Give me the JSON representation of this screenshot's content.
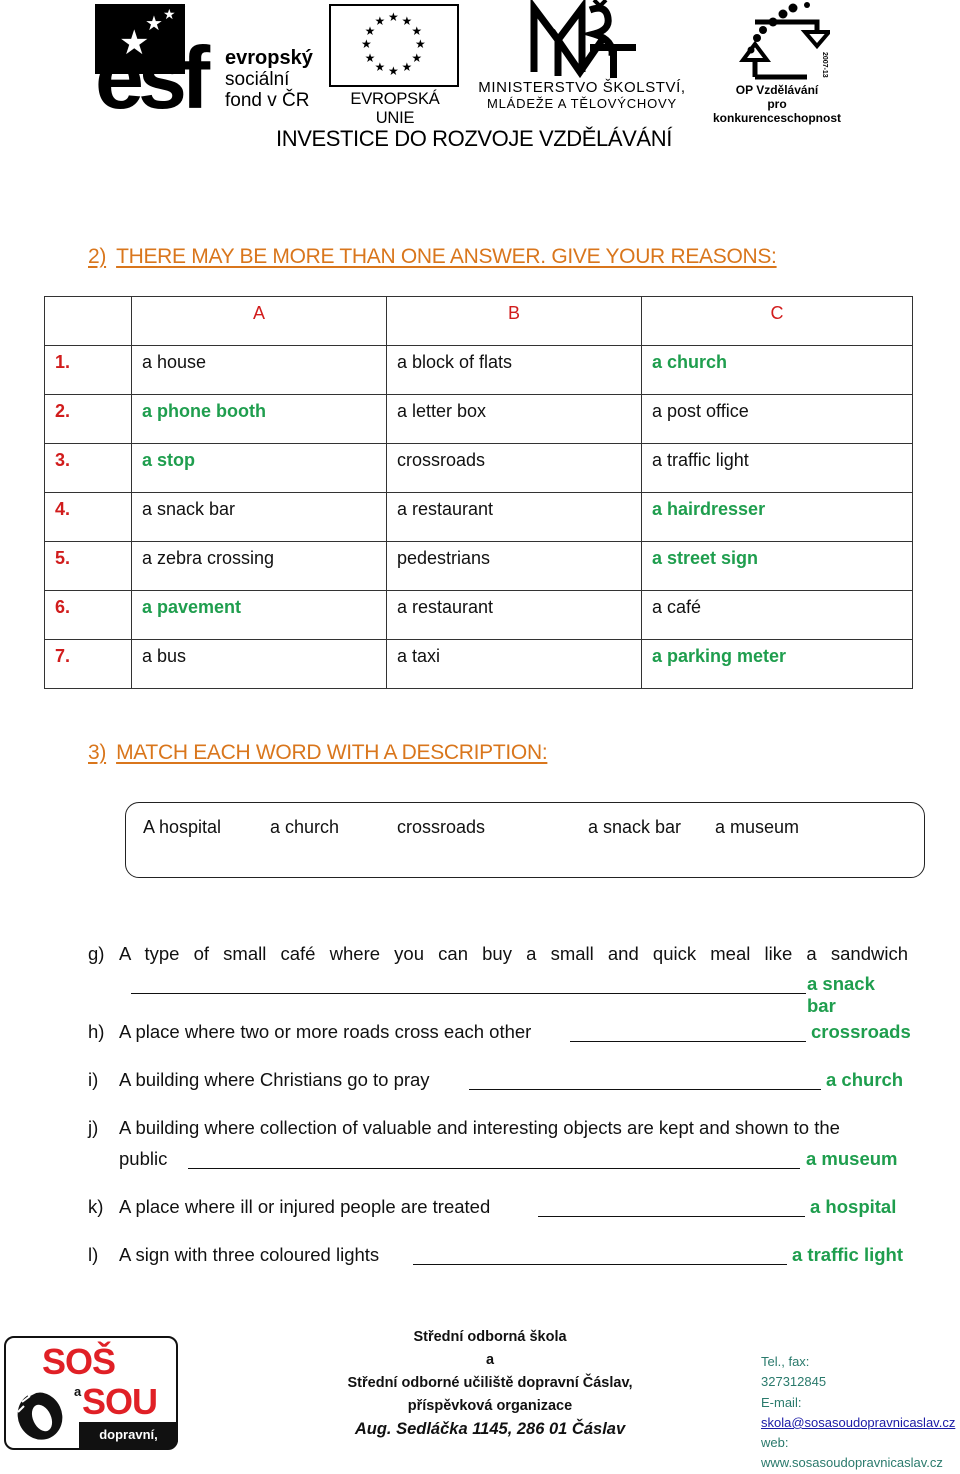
{
  "header": {
    "esf": {
      "letters": "esf",
      "line1": "evropský",
      "line2": "sociální",
      "line3": "fond v ČR"
    },
    "eu": {
      "label": "EVROPSKÁ UNIE"
    },
    "msmt": {
      "logo_text": "MŠMT",
      "line1": "MINISTERSTVO ŠKOLSTVÍ,",
      "line2": "MLÁDEŽE A TĚLOVÝCHOVY"
    },
    "op": {
      "year": "2007-13",
      "line1": "OP Vzdělávání",
      "line2": "pro konkurenceschopnost"
    },
    "tagline": "INVESTICE DO ROZVOJE VZDĚLÁVÁNÍ"
  },
  "colors": {
    "heading": "#d9761c",
    "number": "#d11c1c",
    "answer": "#1f9e4e",
    "contact": "#2a7a6c"
  },
  "section2": {
    "number": "2)",
    "title": "THERE MAY BE MORE THAN ONE ANSWER. GIVE YOUR REASONS:",
    "columns": [
      "A",
      "B",
      "C"
    ],
    "rows": [
      {
        "num": "1.",
        "cells": [
          {
            "text": "a house",
            "answer": false
          },
          {
            "text": "a block of flats",
            "answer": false
          },
          {
            "text": "a church",
            "answer": true
          }
        ]
      },
      {
        "num": "2.",
        "cells": [
          {
            "text": "a phone booth",
            "answer": true
          },
          {
            "text": "a letter box",
            "answer": false
          },
          {
            "text": "a post office",
            "answer": false
          }
        ]
      },
      {
        "num": "3.",
        "cells": [
          {
            "text": "a stop",
            "answer": true
          },
          {
            "text": "crossroads",
            "answer": false
          },
          {
            "text": "a traffic light",
            "answer": false
          }
        ]
      },
      {
        "num": "4.",
        "cells": [
          {
            "text": "a snack bar",
            "answer": false
          },
          {
            "text": "a restaurant",
            "answer": false
          },
          {
            "text": "a hairdresser",
            "answer": true
          }
        ]
      },
      {
        "num": "5.",
        "cells": [
          {
            "text": "a zebra crossing",
            "answer": false
          },
          {
            "text": "pedestrians",
            "answer": false
          },
          {
            "text": "a street sign",
            "answer": true
          }
        ]
      },
      {
        "num": "6.",
        "cells": [
          {
            "text": "a pavement",
            "answer": true
          },
          {
            "text": "a restaurant",
            "answer": false
          },
          {
            "text": "a café",
            "answer": false
          }
        ]
      },
      {
        "num": "7.",
        "cells": [
          {
            "text": "a bus",
            "answer": false
          },
          {
            "text": "a taxi",
            "answer": false
          },
          {
            "text": "a parking meter",
            "answer": true
          }
        ]
      }
    ]
  },
  "section3": {
    "number": "3)",
    "title": "MATCH EACH WORD WITH A DESCRIPTION:",
    "words": [
      "A hospital",
      "a church",
      "crossroads",
      "a snack bar",
      "a museum"
    ],
    "items": [
      {
        "label": "g)",
        "text": "A type of small café where you can buy a small and quick meal like a sandwich",
        "answer": "a snack bar"
      },
      {
        "label": "h)",
        "text": "A place where two or more roads cross each other",
        "answer": "crossroads"
      },
      {
        "label": "i)",
        "text": "A building where Christians go to pray",
        "answer": "a church"
      },
      {
        "label": "j)",
        "text": "A building where collection of valuable and  interesting objects are kept and shown to the",
        "text2": "public",
        "answer": "a museum"
      },
      {
        "label": "k)",
        "text": "A place where ill or injured people are treated",
        "answer": "a hospital"
      },
      {
        "label": "l)",
        "text": "A sign with three coloured lights",
        "answer": "a traffic light"
      }
    ]
  },
  "footer": {
    "logo": {
      "line1": "SOŠ",
      "connector": "a",
      "line2": "SOU",
      "subtitle": "dopravní, Čáslav"
    },
    "school": {
      "line1": "Střední odborná škola",
      "line2": "a",
      "line3": "Střední odborné učiliště dopravní Čáslav,",
      "line4": "příspěvková organizace",
      "address": "Aug. Sedláčka 1145, 286 01 Čáslav"
    },
    "contact": {
      "tel_label": "Tel., fax:",
      "tel": "327312845",
      "email_label": "E-mail:",
      "email": "skola@sosasoudopravnicaslav.cz",
      "web_label": "web:",
      "web": "www.sosasoudopravnicaslav.cz"
    }
  }
}
